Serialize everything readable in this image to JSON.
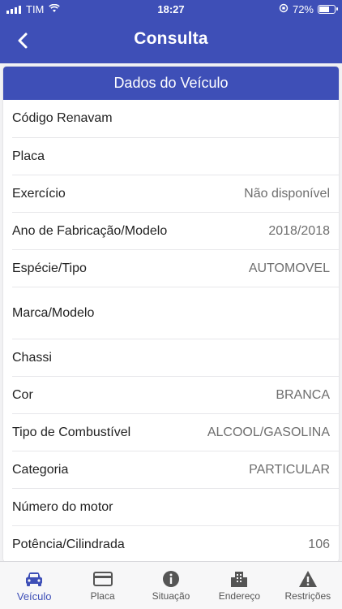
{
  "status_bar": {
    "carrier": "TIM",
    "time": "18:27",
    "battery": "72%",
    "battery_level": 0.72,
    "icons": [
      "signal-icon",
      "wifi-icon",
      "orientation-lock-icon",
      "battery-charging-icon"
    ]
  },
  "nav": {
    "title": "Consulta",
    "back_icon": "chevron-left-icon"
  },
  "card": {
    "header": "Dados do Veículo",
    "rows": [
      {
        "label": "Código Renavam",
        "value": ""
      },
      {
        "label": "Placa",
        "value": ""
      },
      {
        "label": "Exercício",
        "value": "Não disponível"
      },
      {
        "label": "Ano de Fabricação/Modelo",
        "value": "2018/2018"
      },
      {
        "label": "Espécie/Tipo",
        "value": "AUTOMOVEL"
      },
      {
        "label": "Marca/Modelo",
        "value": ""
      },
      {
        "label": "Chassi",
        "value": ""
      },
      {
        "label": "Cor",
        "value": "BRANCA"
      },
      {
        "label": "Tipo de Combustível",
        "value": "ALCOOL/GASOLINA"
      },
      {
        "label": "Categoria",
        "value": "PARTICULAR"
      },
      {
        "label": "Número do motor",
        "value": ""
      },
      {
        "label": "Potência/Cilindrada",
        "value": "106"
      }
    ]
  },
  "tabs": [
    {
      "label": "Veículo",
      "icon": "car-icon",
      "active": true
    },
    {
      "label": "Placa",
      "icon": "card-icon",
      "active": false
    },
    {
      "label": "Situação",
      "icon": "info-icon",
      "active": false
    },
    {
      "label": "Endereço",
      "icon": "building-icon",
      "active": false
    },
    {
      "label": "Restrições",
      "icon": "warning-icon",
      "active": false
    }
  ],
  "colors": {
    "primary": "#3e4fb7",
    "value_text": "#6e6e6e",
    "tab_inactive": "#555555"
  }
}
